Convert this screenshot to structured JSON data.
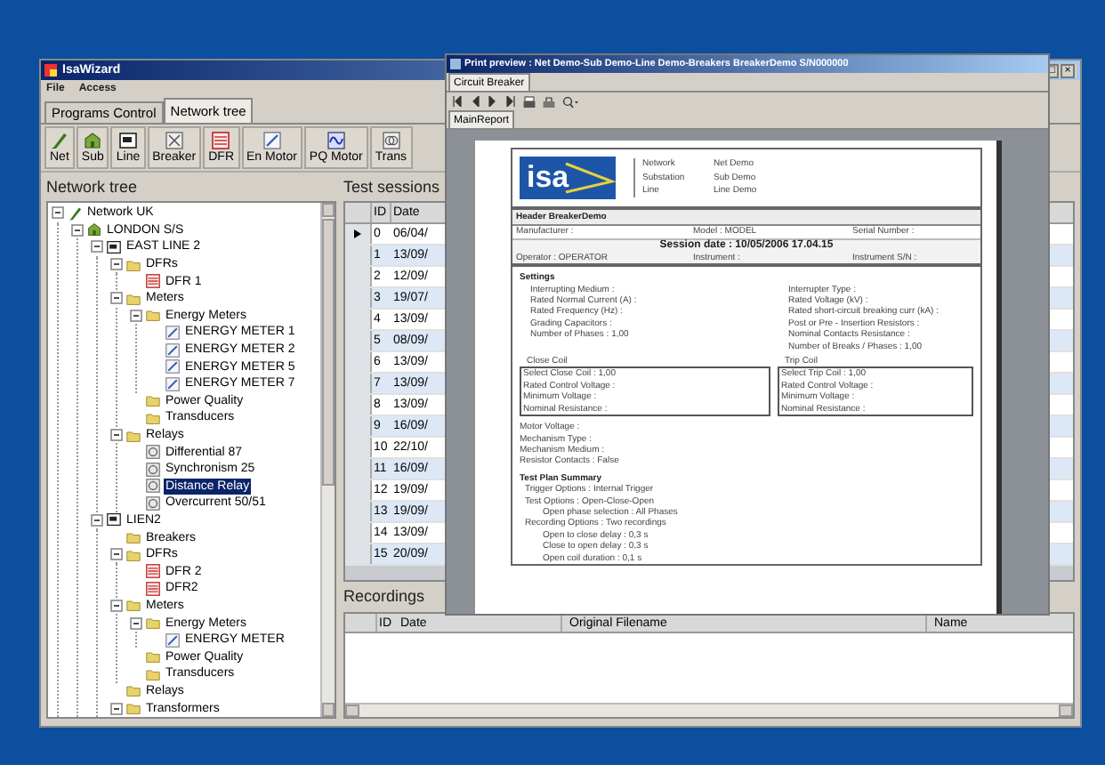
{
  "main_window": {
    "title": "IsaWizard",
    "window_buttons": [
      "□",
      "×"
    ],
    "menu": [
      "File",
      "Access"
    ],
    "tabs": [
      {
        "label": "Programs Control",
        "selected": false
      },
      {
        "label": "Network tree",
        "selected": true
      }
    ],
    "toolbar": [
      {
        "label": "Net",
        "kind": "network"
      },
      {
        "label": "Sub",
        "kind": "substation"
      },
      {
        "label": "Line",
        "kind": "line"
      },
      {
        "label": "Breaker",
        "kind": "breaker"
      },
      {
        "label": "DFR",
        "kind": "dfr"
      },
      {
        "label": "En Motor",
        "kind": "meter"
      },
      {
        "label": "PQ Motor",
        "kind": "pq"
      },
      {
        "label": "Trans",
        "kind": "trans"
      }
    ],
    "network_tree": {
      "title": "Network tree",
      "items": [
        {
          "label": "Network UK",
          "kind": "network",
          "expanded": true,
          "selected": false,
          "children": [
            {
              "label": "LONDON S/S",
              "kind": "substation",
              "expanded": true,
              "selected": false,
              "children": [
                {
                  "label": "EAST LINE 2",
                  "kind": "line",
                  "expanded": true,
                  "selected": false,
                  "children": [
                    {
                      "label": "DFRs",
                      "kind": "folder",
                      "expanded": true,
                      "selected": false,
                      "children": [
                        {
                          "label": "DFR 1",
                          "kind": "dfr",
                          "selected": false
                        }
                      ]
                    },
                    {
                      "label": "Meters",
                      "kind": "folder",
                      "expanded": true,
                      "selected": false,
                      "children": [
                        {
                          "label": "Energy Meters",
                          "kind": "folder",
                          "expanded": true,
                          "selected": false,
                          "children": [
                            {
                              "label": "ENERGY METER 1",
                              "kind": "meter",
                              "selected": false
                            },
                            {
                              "label": "ENERGY METER 2",
                              "kind": "meter",
                              "selected": false
                            },
                            {
                              "label": "ENERGY METER 5",
                              "kind": "meter",
                              "selected": false
                            },
                            {
                              "label": "ENERGY METER 7",
                              "kind": "meter",
                              "selected": false
                            }
                          ]
                        },
                        {
                          "label": "Power Quality",
                          "kind": "folder",
                          "selected": false
                        },
                        {
                          "label": "Transducers",
                          "kind": "folder",
                          "selected": false
                        }
                      ]
                    },
                    {
                      "label": "Relays",
                      "kind": "folder",
                      "expanded": true,
                      "selected": false,
                      "children": [
                        {
                          "label": "Differential 87",
                          "kind": "relay",
                          "selected": false
                        },
                        {
                          "label": "Synchronism 25",
                          "kind": "relay",
                          "selected": false
                        },
                        {
                          "label": "Distance Relay",
                          "kind": "relay",
                          "selected": true
                        },
                        {
                          "label": "Overcurrent 50/51",
                          "kind": "relay",
                          "selected": false
                        }
                      ]
                    }
                  ]
                },
                {
                  "label": "LIEN2",
                  "kind": "line",
                  "expanded": true,
                  "selected": false,
                  "children": [
                    {
                      "label": "Breakers",
                      "kind": "folder",
                      "selected": false
                    },
                    {
                      "label": "DFRs",
                      "kind": "folder",
                      "expanded": true,
                      "selected": false,
                      "children": [
                        {
                          "label": "DFR 2",
                          "kind": "dfr",
                          "selected": false
                        },
                        {
                          "label": "DFR2",
                          "kind": "dfr",
                          "selected": false
                        }
                      ]
                    },
                    {
                      "label": "Meters",
                      "kind": "folder",
                      "expanded": true,
                      "selected": false,
                      "children": [
                        {
                          "label": "Energy Meters",
                          "kind": "folder",
                          "expanded": true,
                          "selected": false,
                          "children": [
                            {
                              "label": "ENERGY METER",
                              "kind": "meter",
                              "selected": false
                            }
                          ]
                        },
                        {
                          "label": "Power Quality",
                          "kind": "folder",
                          "selected": false
                        },
                        {
                          "label": "Transducers",
                          "kind": "folder",
                          "selected": false
                        }
                      ]
                    },
                    {
                      "label": "Relays",
                      "kind": "folder",
                      "selected": false
                    },
                    {
                      "label": "Transformers",
                      "kind": "folder",
                      "expanded": true,
                      "selected": false
                    }
                  ]
                }
              ]
            }
          ]
        }
      ]
    },
    "test_sessions": {
      "title": "Test sessions",
      "columns": [
        "ID",
        "Date"
      ],
      "rows": [
        {
          "id": "0",
          "date": "06/04/",
          "selected": true
        },
        {
          "id": "1",
          "date": "13/09/",
          "selected": false
        },
        {
          "id": "2",
          "date": "12/09/",
          "selected": false
        },
        {
          "id": "3",
          "date": "19/07/",
          "selected": false
        },
        {
          "id": "4",
          "date": "13/09/",
          "selected": false
        },
        {
          "id": "5",
          "date": "08/09/",
          "selected": false
        },
        {
          "id": "6",
          "date": "13/09/",
          "selected": false
        },
        {
          "id": "7",
          "date": "13/09/",
          "selected": false
        },
        {
          "id": "8",
          "date": "13/09/",
          "selected": false
        },
        {
          "id": "9",
          "date": "16/09/",
          "selected": false
        },
        {
          "id": "10",
          "date": "22/10/",
          "selected": false
        },
        {
          "id": "11",
          "date": "16/09/",
          "selected": false
        },
        {
          "id": "12",
          "date": "19/09/",
          "selected": false
        },
        {
          "id": "13",
          "date": "19/09/",
          "selected": false
        },
        {
          "id": "14",
          "date": "13/09/",
          "selected": false
        },
        {
          "id": "15",
          "date": "20/09/",
          "selected": false
        }
      ]
    },
    "recordings": {
      "title": "Recordings",
      "columns": [
        "ID",
        "Date",
        "Original Filename",
        "Name"
      ]
    }
  },
  "print_preview": {
    "title": "Print preview : Net Demo-Sub Demo-Line Demo-Breakers BreakerDemo S/N000000",
    "tab": "Circuit Breaker",
    "report_tab": "MainReport",
    "report": {
      "logo": "isa",
      "header_rows": [
        {
          "label": "Network",
          "value": "Net Demo"
        },
        {
          "label": "Substation",
          "value": "Sub Demo"
        },
        {
          "label": "Line",
          "value": "Line Demo"
        }
      ],
      "section_title": "Header BreakerDemo",
      "info_row": [
        "Manufacturer :",
        "Model : MODEL",
        "Serial Number :"
      ],
      "session_date": "Session date : 10/05/2006  17.04.15",
      "operator_row": [
        "Operator : OPERATOR",
        "Instrument :",
        "Instrument S/N :"
      ],
      "settings_title": "Settings",
      "settings_left": [
        "Interrupting Medium :",
        "Rated Normal Current (A) :",
        "Rated Frequency (Hz) :",
        "Grading Capacitors :",
        "Number of Phases : 1,00"
      ],
      "settings_right": [
        "Interrupter Type :",
        "Rated Voltage (kV) :",
        "Rated short-circuit breaking curr (kA) :",
        "Post or Pre - Insertion Resistors :",
        "Nominal Contacts Resistance :",
        "Number of Breaks / Phases : 1,00"
      ],
      "coils": [
        {
          "title": "Close Coil",
          "lines": [
            "Select Close Coil : 1,00",
            "Rated Control Voltage :",
            "Minimum Voltage :",
            "Nominal Resistance :"
          ]
        },
        {
          "title": "Trip Coil",
          "lines": [
            "Select Trip Coil : 1,00",
            "Rated Control Voltage :",
            "Minimum Voltage :",
            "Nominal Resistance :"
          ]
        }
      ],
      "mechanism": [
        "Motor Voltage :",
        "Mechanism Type :",
        "Mechanism Medium :",
        "Resistor Contacts : False"
      ],
      "test_plan_title": "Test Plan Summary",
      "test_plan": [
        {
          "text": "Trigger Options : Internal Trigger"
        },
        {
          "text": "Test Options : Open-Close-Open",
          "children": [
            {
              "text": "Open phase selection : All Phases"
            }
          ]
        },
        {
          "text": "Recording Options : Two recordings",
          "children": [
            {
              "text": "Open to close delay : 0,3 s"
            },
            {
              "text": "Close to open delay : 0,3 s"
            },
            {
              "text": "Open coil duration : 0,1 s"
            }
          ]
        }
      ]
    }
  }
}
